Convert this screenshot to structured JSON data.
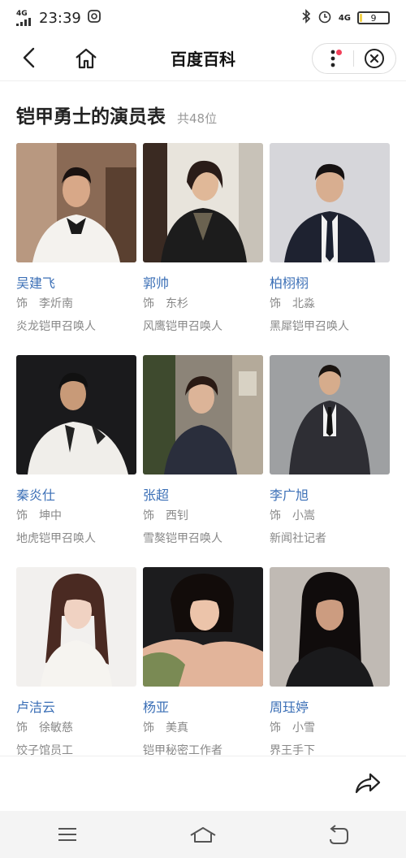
{
  "status_bar": {
    "network": "4G",
    "time": "23:39",
    "network_right": "4G",
    "battery_level": "9",
    "battery_fraction": 0.09,
    "icons": [
      "signal-icon",
      "app-notification-icon",
      "bluetooth-icon",
      "alarm-icon",
      "battery-icon"
    ]
  },
  "nav": {
    "title": "百度百科",
    "icons": [
      "back-icon",
      "home-icon",
      "more-icon",
      "close-icon"
    ]
  },
  "heading": {
    "title": "铠甲勇士的演员表",
    "count": "共48位"
  },
  "cast": [
    {
      "name": "吴建飞",
      "role_label": "饰",
      "role": "李炘南",
      "desc": "炎龙铠甲召唤人"
    },
    {
      "name": "郭帅",
      "role_label": "饰",
      "role": "东杉",
      "desc": "风鹰铠甲召唤人"
    },
    {
      "name": "柏栩栩",
      "role_label": "饰",
      "role": "北淼",
      "desc": "黑犀铠甲召唤人"
    },
    {
      "name": "秦炎仕",
      "role_label": "饰",
      "role": "坤中",
      "desc": "地虎铠甲召唤人"
    },
    {
      "name": "张超",
      "role_label": "饰",
      "role": "西钊",
      "desc": "雪獒铠甲召唤人"
    },
    {
      "name": "李广旭",
      "role_label": "饰",
      "role": "小嵩",
      "desc": "新闻社记者"
    },
    {
      "name": "卢洁云",
      "role_label": "饰",
      "role": "徐敏慈",
      "desc": "饺子馆员工"
    },
    {
      "name": "杨亚",
      "role_label": "饰",
      "role": "美真",
      "desc": "铠甲秘密工作者"
    },
    {
      "name": "周珏婷",
      "role_label": "饰",
      "role": "小雪",
      "desc": "界王手下"
    }
  ],
  "colors": {
    "link": "#3b6fb6",
    "muted": "#888888",
    "notification_dot": "#f2405a",
    "battery_fill": "#f3d24a"
  },
  "bottom": {
    "icons": [
      "share-icon",
      "menu-icon",
      "home-outline-icon",
      "back-return-icon"
    ]
  }
}
